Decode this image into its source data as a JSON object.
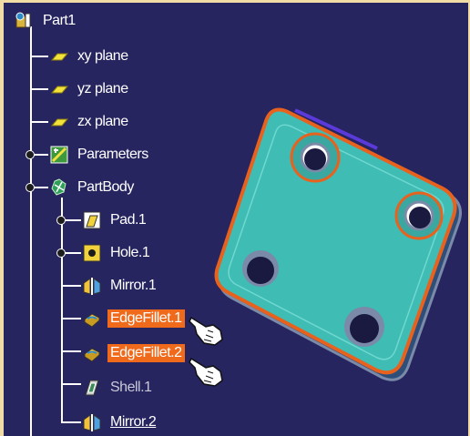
{
  "tree": {
    "root": {
      "label": "Part1",
      "icon": "part-icon"
    },
    "items": [
      {
        "label": "xy plane",
        "icon": "plane-icon"
      },
      {
        "label": "yz plane",
        "icon": "plane-icon"
      },
      {
        "label": "zx plane",
        "icon": "plane-icon"
      },
      {
        "label": "Parameters",
        "icon": "parameters-icon"
      },
      {
        "label": "PartBody",
        "icon": "partbody-icon"
      },
      {
        "label": "Pad.1",
        "icon": "pad-icon"
      },
      {
        "label": "Hole.1",
        "icon": "hole-icon"
      },
      {
        "label": "Mirror.1",
        "icon": "mirror-icon"
      },
      {
        "label": "EdgeFillet.1",
        "icon": "edgefillet-icon",
        "selected": true
      },
      {
        "label": "EdgeFillet.2",
        "icon": "edgefillet-icon",
        "selected": true
      },
      {
        "label": "Shell.1",
        "icon": "shell-icon"
      },
      {
        "label": "Mirror.2",
        "icon": "mirror-icon",
        "underlined": true
      }
    ]
  },
  "colors": {
    "background": "#262560",
    "frame": "#f1dca6",
    "selection": "#f06a1c",
    "part_face": "#3fbcb4",
    "part_edge_highlight": "#e8621e"
  }
}
